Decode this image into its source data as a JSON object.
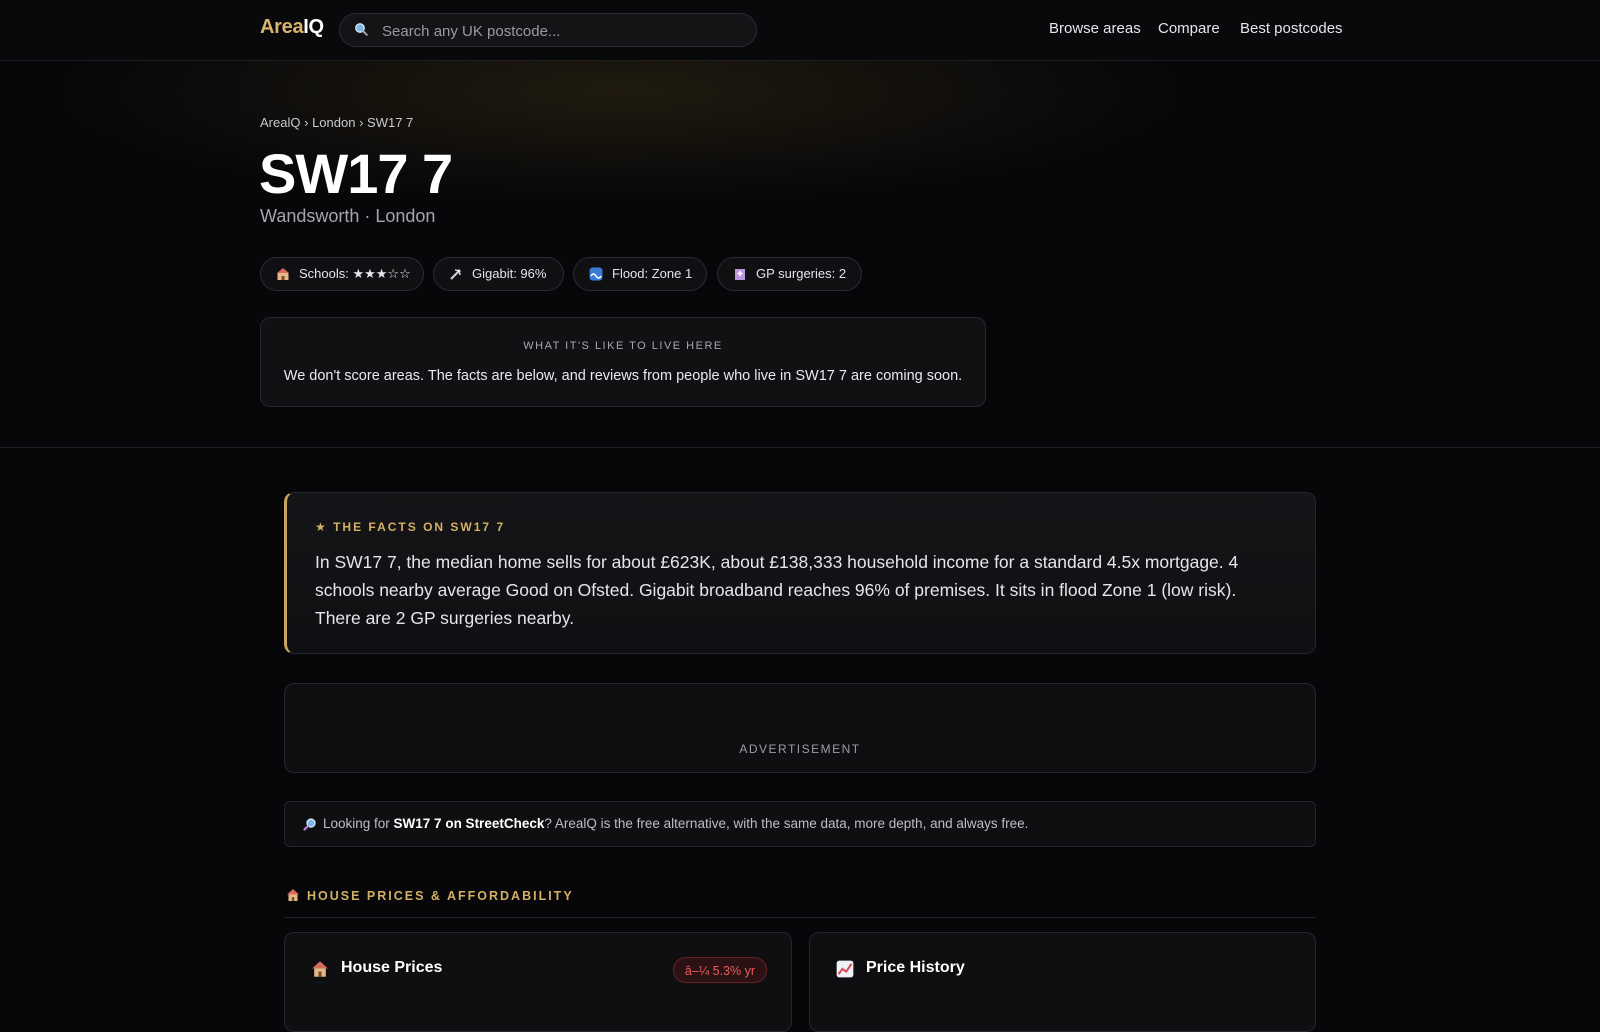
{
  "header": {
    "logo_part1": "Area",
    "logo_part2": "IQ",
    "search_placeholder": "Search any UK postcode...",
    "nav": [
      "Browse areas",
      "Compare",
      "Best postcodes"
    ]
  },
  "hero": {
    "breadcrumb": [
      "ArealQ",
      "London",
      "SW17 7"
    ],
    "breadcrumb_sep": "›",
    "title": "SW17 7",
    "subtitle": "Wandsworth · London",
    "pills": [
      {
        "icon": "school-icon",
        "label": "Schools: ★★★☆☆"
      },
      {
        "icon": "satellite-icon",
        "label": "Gigabit: 96%"
      },
      {
        "icon": "wave-icon",
        "label": "Flood: Zone 1"
      },
      {
        "icon": "hospital-icon",
        "label": "GP surgeries: 2"
      }
    ],
    "live_label": "WHAT IT'S LIKE TO LIVE HERE",
    "live_text": "We don't score areas. The facts are below, and reviews from people who live in SW17 7 are coming soon."
  },
  "facts": {
    "heading": "★ THE FACTS ON SW17 7",
    "body": "In SW17 7, the median home sells for about £623K, about £138,333 household income for a standard 4.5x mortgage. 4 schools nearby average Good on Ofsted. Gigabit broadband reaches 96% of premises. It sits in flood Zone 1 (low risk). There are 2 GP surgeries nearby."
  },
  "ad": {
    "label": "ADVERTISEMENT"
  },
  "streetcheck": {
    "prefix": "Looking for ",
    "link": "SW17 7 on StreetCheck",
    "suffix": "? ArealQ is the free alternative, with the same data, more depth, and always free."
  },
  "section": {
    "title": "HOUSE PRICES & AFFORDABILITY"
  },
  "cards": [
    {
      "title": "House Prices",
      "badge": "â–¼ 5.3% yr",
      "icon": "house-icon"
    },
    {
      "title": "Price History",
      "icon": "chart-icon"
    }
  ],
  "colors": {
    "accent": "#d3b063",
    "background": "#07070a",
    "negative": "#ef5a5a"
  }
}
